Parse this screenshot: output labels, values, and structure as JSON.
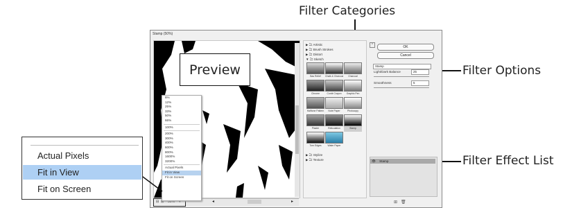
{
  "callouts": {
    "filter_categories": "Filter Categories",
    "filter_options": "Filter Options",
    "filter_effect_list": "Filter Effect List",
    "preview": "Preview"
  },
  "dialog": {
    "title": "Stamp (50%)",
    "zoom_value": "50%",
    "zoom_menu": [
      "6%",
      "12%",
      "25%",
      "33%",
      "50%",
      "66%",
      "100%",
      "200%",
      "300%",
      "400%",
      "600%",
      "800%",
      "1600%",
      "3200%",
      "Actual Pixels",
      "Fit in View",
      "Fit on Screen"
    ],
    "zoom_selected": "Fit in View"
  },
  "categories": {
    "top": [
      "Artistic",
      "Brush Strokes",
      "Distort",
      "Sketch"
    ],
    "bottom": [
      "Stylize",
      "Texture"
    ],
    "sketch_filters": [
      "Bas Relief",
      "Chalk & Charcoal",
      "Charcoal",
      "Chrome",
      "Conté Crayon",
      "Graphic Pen",
      "Halftone Pattern",
      "Note Paper",
      "Photocopy",
      "Plaster",
      "Reticulation",
      "Stamp",
      "Torn Edges",
      "Water Paper"
    ],
    "selected_filter": "Stamp"
  },
  "options": {
    "ok_label": "OK",
    "cancel_label": "Cancel",
    "filter_select": "Stamp",
    "light_dark_label": "Light/Dark Balance",
    "light_dark_value": "25",
    "smoothness_label": "Smoothness",
    "smoothness_value": "5"
  },
  "effect_list": {
    "items": [
      "Stamp"
    ]
  },
  "zoom_callout": {
    "items": [
      "Actual Pixels",
      "Fit in View",
      "Fit on Screen"
    ],
    "selected": "Fit in View"
  }
}
